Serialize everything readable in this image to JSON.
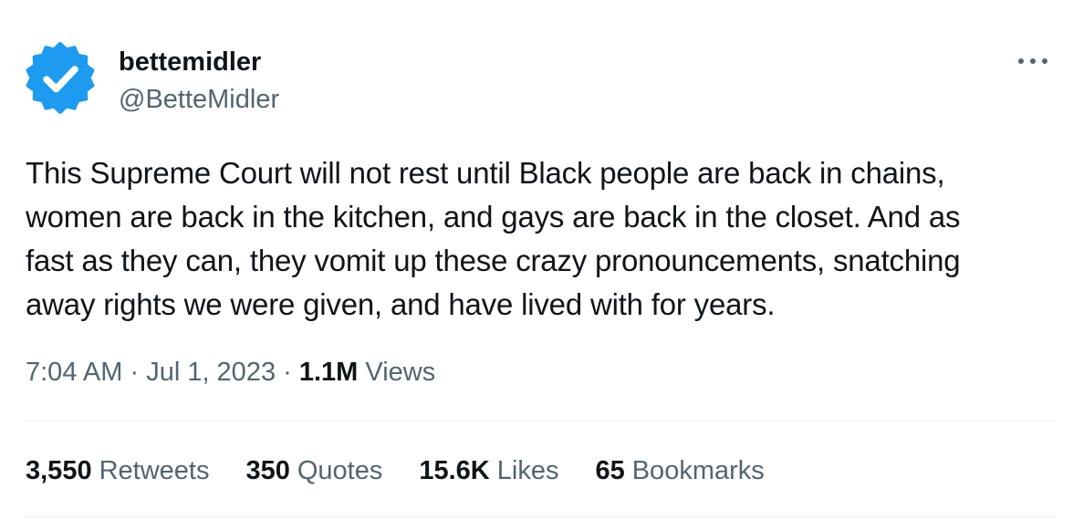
{
  "author": {
    "name": "bettemidler",
    "handle": "@BetteMidler",
    "verified_badge_color": "#1d9bf0"
  },
  "tweet": {
    "text": "This Supreme Court will not rest until Black people are back in chains,\nwomen are back in the kitchen, and gays are back in the closet.  And as\nfast as they can, they vomit up these crazy pronouncements, snatching\naway rights we were given, and have lived with for years.",
    "time": "7:04 AM",
    "date": "Jul 1, 2023",
    "views_count": "1.1M",
    "views_label": "Views"
  },
  "stats": {
    "retweets": {
      "count": "3,550",
      "label": "Retweets"
    },
    "quotes": {
      "count": "350",
      "label": "Quotes"
    },
    "likes": {
      "count": "15.6K",
      "label": "Likes"
    },
    "bookmarks": {
      "count": "65",
      "label": "Bookmarks"
    }
  },
  "icons": {
    "avatar": "verified-badge-icon",
    "more": "more-horizontal-icon"
  },
  "colors": {
    "text_primary": "#0f1419",
    "text_secondary": "#536471",
    "accent": "#1d9bf0",
    "divider": "#eff3f4"
  }
}
